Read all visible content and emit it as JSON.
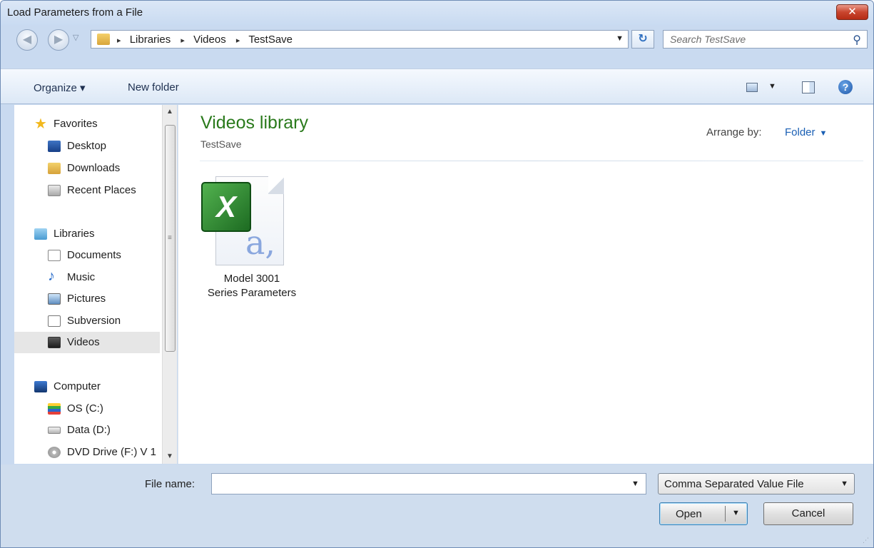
{
  "window": {
    "title": "Load Parameters from a File",
    "close_glyph": "✕"
  },
  "nav": {
    "back_glyph": "◀",
    "forward_glyph": "▶",
    "history_glyph": "▽"
  },
  "address": {
    "crumbs": [
      "Libraries",
      "Videos",
      "TestSave"
    ],
    "arrow_glyph": "▸",
    "dropdown_glyph": "▼",
    "refresh_glyph": "↻"
  },
  "search": {
    "placeholder": "Search TestSave",
    "icon": "search-icon",
    "glyph": "⚲"
  },
  "toolbar": {
    "organize_label": "Organize ▾",
    "new_folder_label": "New folder",
    "view_dropdown_glyph": "▼",
    "help_glyph": "?"
  },
  "sidebar": {
    "groups": [
      {
        "label": "Favorites",
        "icon": "star-icon",
        "glyph": "★",
        "items": [
          {
            "label": "Desktop",
            "icon": "desktop-icon"
          },
          {
            "label": "Downloads",
            "icon": "downloads-icon"
          },
          {
            "label": "Recent Places",
            "icon": "recent-places-icon"
          }
        ]
      },
      {
        "label": "Libraries",
        "icon": "libraries-icon",
        "items": [
          {
            "label": "Documents",
            "icon": "documents-icon"
          },
          {
            "label": "Music",
            "icon": "music-icon",
            "glyph": "♪"
          },
          {
            "label": "Pictures",
            "icon": "pictures-icon"
          },
          {
            "label": "Subversion",
            "icon": "subversion-icon"
          },
          {
            "label": "Videos",
            "icon": "videos-icon",
            "selected": true
          }
        ]
      },
      {
        "label": "Computer",
        "icon": "computer-icon",
        "items": [
          {
            "label": "OS (C:)",
            "icon": "os-drive-icon"
          },
          {
            "label": "Data (D:)",
            "icon": "data-drive-icon"
          },
          {
            "label": "DVD Drive (F:) V 1",
            "icon": "dvd-drive-icon"
          }
        ]
      }
    ],
    "scroll_up_glyph": "▲",
    "scroll_down_glyph": "▼",
    "grip_glyph": "≡"
  },
  "content": {
    "title": "Videos library",
    "subtitle": "TestSave",
    "arrange_label": "Arrange by:",
    "arrange_value": "Folder",
    "arrange_drop_glyph": "▼",
    "files": [
      {
        "line1": "Model 3001",
        "line2": "Series Parameters",
        "badge": "X",
        "glyph": "a,"
      }
    ]
  },
  "footer": {
    "file_name_label": "File name:",
    "file_name_value": "",
    "file_name_drop_glyph": "▼",
    "file_type_value": "Comma Separated Value File",
    "file_type_drop_glyph": "▼",
    "open_label": "Open",
    "open_drop_glyph": "▼",
    "cancel_label": "Cancel",
    "resize_glyph": "⋰"
  },
  "colors": {
    "accent": "#2a7a1c",
    "link": "#1a5fb4",
    "chrome": "#c9daf0"
  }
}
